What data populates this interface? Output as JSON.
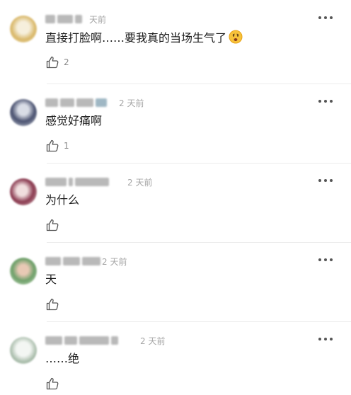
{
  "comments": [
    {
      "time": "天前",
      "text": "直接打脸啊……要我真的当场生气了",
      "emoji": "worried-face-emoji",
      "likes": "2",
      "avatar_colors": [
        "#f2ead2",
        "#e1c98c"
      ]
    },
    {
      "time": "2 天前",
      "text": "感觉好痛啊",
      "likes": "1",
      "avatar_colors": [
        "#c9cdd8",
        "#3d4560"
      ]
    },
    {
      "time": "2 天前",
      "text": "为什么",
      "likes": "",
      "avatar_colors": [
        "#e9d8d8",
        "#8c3f52"
      ]
    },
    {
      "time": "2 天前",
      "text": "天",
      "likes": "",
      "avatar_colors": [
        "#cfe0c2",
        "#6f9c6a"
      ]
    },
    {
      "time": "2 天前",
      "text": "……绝",
      "likes": "",
      "avatar_colors": [
        "#e6ece6",
        "#9fb3a3"
      ]
    }
  ]
}
